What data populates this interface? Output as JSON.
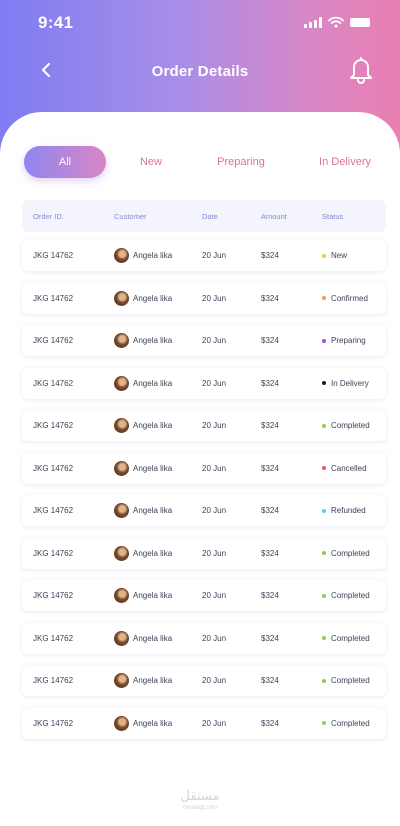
{
  "status_bar": {
    "time": "9:41"
  },
  "nav": {
    "title": "Order Details"
  },
  "tabs": [
    {
      "label": "All",
      "active": true
    },
    {
      "label": "New",
      "active": false
    },
    {
      "label": "Preparing",
      "active": false
    },
    {
      "label": "In Delivery",
      "active": false
    }
  ],
  "table": {
    "columns": [
      "Order ID.",
      "Customer",
      "Date",
      "Amount",
      "Status"
    ],
    "rows": [
      {
        "id": "JKG 14762",
        "customer": "Angela lika",
        "date": "20 Jun",
        "amount": "$324",
        "status": "New",
        "status_color": "#f2c94c"
      },
      {
        "id": "JKG 14762",
        "customer": "Angela lika",
        "date": "20 Jun",
        "amount": "$324",
        "status": "Confirmed",
        "status_color": "#f2994a"
      },
      {
        "id": "JKG 14762",
        "customer": "Angela lika",
        "date": "20 Jun",
        "amount": "$324",
        "status": "Preparing",
        "status_color": "#9b51e0"
      },
      {
        "id": "JKG 14762",
        "customer": "Angela lika",
        "date": "20 Jun",
        "amount": "$324",
        "status": "In Delivery",
        "status_color": "#1b1b2f"
      },
      {
        "id": "JKG 14762",
        "customer": "Angela lika",
        "date": "20 Jun",
        "amount": "$324",
        "status": "Completed",
        "status_color": "#8cd13f"
      },
      {
        "id": "JKG 14762",
        "customer": "Angela lika",
        "date": "20 Jun",
        "amount": "$324",
        "status": "Cancelled",
        "status_color": "#eb5757"
      },
      {
        "id": "JKG 14762",
        "customer": "Angela lika",
        "date": "20 Jun",
        "amount": "$324",
        "status": "Refunded",
        "status_color": "#56ccf2"
      },
      {
        "id": "JKG 14762",
        "customer": "Angela lika",
        "date": "20 Jun",
        "amount": "$324",
        "status": "Completed",
        "status_color": "#8cd13f"
      },
      {
        "id": "JKG 14762",
        "customer": "Angela lika",
        "date": "20 Jun",
        "amount": "$324",
        "status": "Completed",
        "status_color": "#8cd13f"
      },
      {
        "id": "JKG 14762",
        "customer": "Angela lika",
        "date": "20 Jun",
        "amount": "$324",
        "status": "Completed",
        "status_color": "#8cd13f"
      },
      {
        "id": "JKG 14762",
        "customer": "Angela lika",
        "date": "20 Jun",
        "amount": "$324",
        "status": "Completed",
        "status_color": "#8cd13f"
      },
      {
        "id": "JKG 14762",
        "customer": "Angela lika",
        "date": "20 Jun",
        "amount": "$324",
        "status": "Completed",
        "status_color": "#8cd13f"
      }
    ]
  },
  "watermark": {
    "text": "مستقل",
    "sub": "mostaql.com"
  },
  "icons": {
    "back": "chevron-left-icon",
    "bell": "bell-icon",
    "signal": "signal-icon",
    "wifi": "wifi-icon",
    "battery": "battery-icon",
    "avatar": "avatar"
  },
  "colors": {
    "header_gradient_start": "#7f7cf2",
    "header_gradient_end": "#e97fb2",
    "tab_inactive": "#d9739f",
    "table_header_text": "#8a87d6"
  }
}
